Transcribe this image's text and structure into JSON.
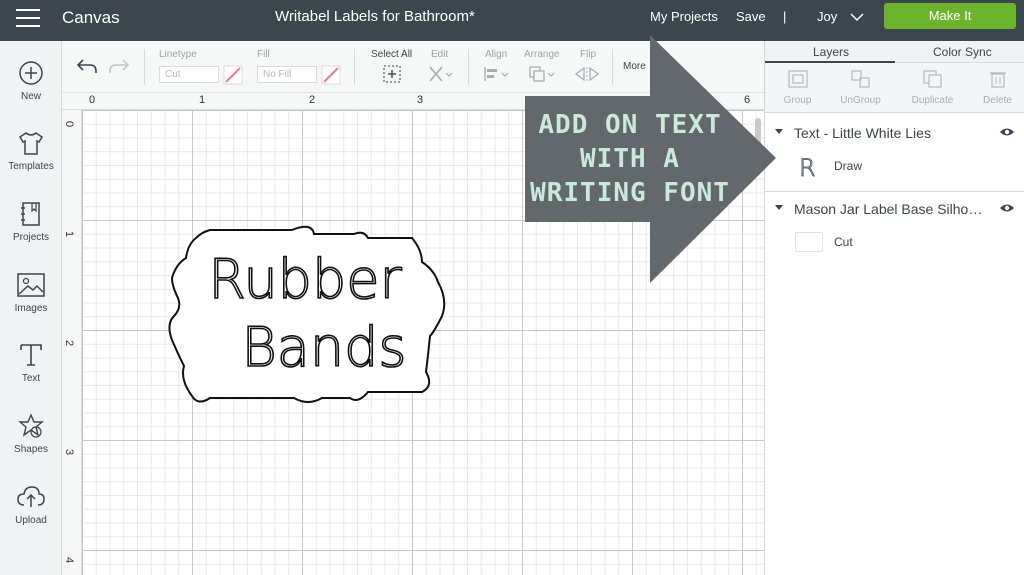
{
  "app": {
    "title": "Canvas",
    "document_title": "Writabel Labels for Bathroom*"
  },
  "nav": {
    "my_projects": "My Projects",
    "save": "Save",
    "separator": "|",
    "user": "Joy",
    "make_it": "Make It"
  },
  "sidebar": {
    "items": [
      {
        "label": "New",
        "icon": "plus-circle-icon"
      },
      {
        "label": "Templates",
        "icon": "shirt-icon"
      },
      {
        "label": "Projects",
        "icon": "notebook-icon"
      },
      {
        "label": "Images",
        "icon": "image-icon"
      },
      {
        "label": "Text",
        "icon": "text-t-icon"
      },
      {
        "label": "Shapes",
        "icon": "shapes-icon"
      },
      {
        "label": "Upload",
        "icon": "cloud-upload-icon"
      }
    ]
  },
  "toolbar": {
    "linetype_label": "Linetype",
    "linetype_value": "Cut",
    "fill_label": "Fill",
    "fill_value": "No Fill",
    "select_all_label": "Select All",
    "edit_label": "Edit",
    "align_label": "Align",
    "arrange_label": "Arrange",
    "flip_label": "Flip",
    "more_label": "More"
  },
  "ruler": {
    "top": [
      "0",
      "1",
      "2",
      "3",
      "6"
    ],
    "left": [
      "0",
      "1",
      "2",
      "3",
      "4"
    ]
  },
  "design": {
    "line1": "Rubber",
    "line2": "Bands"
  },
  "panel": {
    "tabs": [
      "Layers",
      "Color Sync"
    ],
    "tools": [
      "Group",
      "UnGroup",
      "Duplicate",
      "Delete"
    ],
    "groups": [
      {
        "title": "Text - Little White Lies",
        "layer_label": "Draw",
        "layer_icon_letter": "R"
      },
      {
        "title": "Mason Jar Label Base Silho…",
        "layer_label": "Cut"
      }
    ]
  },
  "callout": {
    "lines": [
      "ADD ON TEXT",
      "WITH A",
      "WRITING FONT"
    ]
  },
  "colors": {
    "topbar": "#3d454e",
    "make_it": "#6cb42c",
    "callout_arrow": "#62686c",
    "callout_text": "#c8ead8",
    "slash": "#e8808e"
  }
}
